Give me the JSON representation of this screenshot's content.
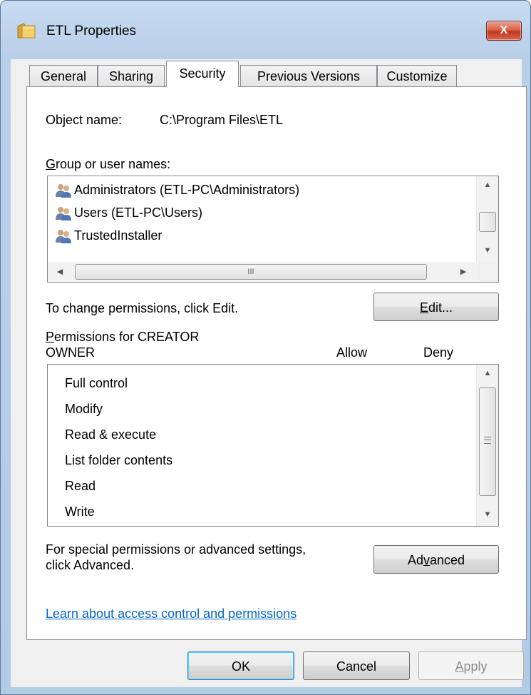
{
  "window": {
    "title": "ETL Properties",
    "close_glyph": "X"
  },
  "tabs": [
    {
      "label": "General",
      "active": false
    },
    {
      "label": "Sharing",
      "active": false
    },
    {
      "label": "Security",
      "active": true
    },
    {
      "label": "Previous Versions",
      "active": false
    },
    {
      "label": "Customize",
      "active": false
    }
  ],
  "security": {
    "object_name_label": "Object name:",
    "object_name_value": "C:\\Program Files\\ETL",
    "group_label": "Group or user names:",
    "groups": [
      {
        "name": "Administrators (ETL-PC\\Administrators)",
        "icon": "users-group-icon"
      },
      {
        "name": "Users (ETL-PC\\Users)",
        "icon": "users-group-icon"
      },
      {
        "name": "TrustedInstaller",
        "icon": "users-group-icon"
      }
    ],
    "hscroll_grip": "III",
    "change_hint": "To change permissions, click Edit.",
    "edit_button": "Edit...",
    "permissions_label_line1": "Permissions for CREATOR",
    "permissions_label_line2": "OWNER",
    "col_allow": "Allow",
    "col_deny": "Deny",
    "permissions": [
      "Full control",
      "Modify",
      "Read & execute",
      "List folder contents",
      "Read",
      "Write"
    ],
    "advanced_hint_line1": "For special permissions or advanced settings,",
    "advanced_hint_line2": "click Advanced.",
    "advanced_button": "Advanced",
    "learn_link": "Learn about access control and permissions"
  },
  "footer": {
    "ok": "OK",
    "cancel": "Cancel",
    "apply": "Apply"
  }
}
